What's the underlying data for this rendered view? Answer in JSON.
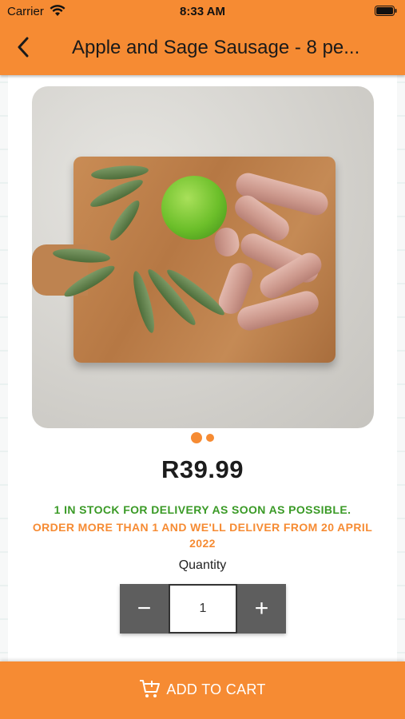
{
  "status_bar": {
    "carrier": "Carrier",
    "time": "8:33 AM"
  },
  "header": {
    "title": "Apple and Sage Sausage - 8 pe..."
  },
  "product": {
    "price": "R39.99",
    "stock_text": "1 IN STOCK FOR DELIVERY AS SOON AS POSSIBLE.",
    "delivery_text": "ORDER MORE THAN 1 AND WE'LL DELIVER FROM 20 APRIL 2022",
    "image_count": 2,
    "active_image": 1
  },
  "quantity": {
    "label": "Quantity",
    "value": "1",
    "decrement": "−",
    "increment": "+"
  },
  "cart": {
    "label": "ADD TO CART",
    "icon": "cart-plus-icon"
  },
  "colors": {
    "accent": "#f68b33",
    "stock_green": "#3a9a26",
    "stepper_gray": "#5e5e5e"
  }
}
